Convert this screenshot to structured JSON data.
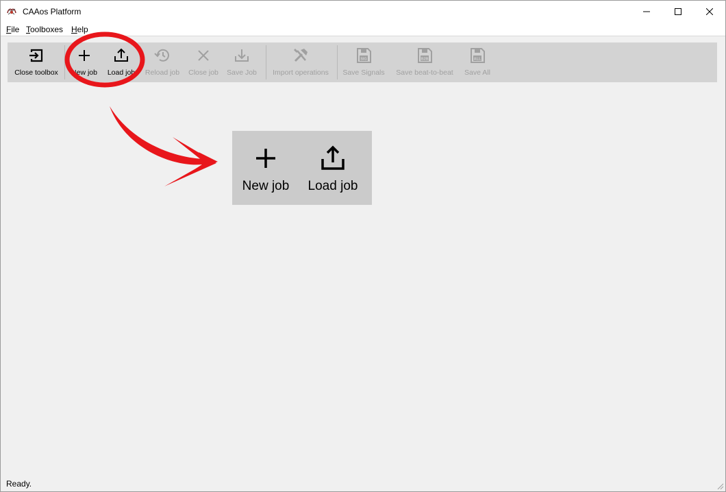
{
  "window": {
    "title": "CAAos Platform"
  },
  "menu": {
    "file": {
      "underline": "F",
      "rest": "ile"
    },
    "toolboxes": {
      "underline": "T",
      "rest": "oolboxes"
    },
    "help": {
      "underline": "H",
      "rest": "elp"
    }
  },
  "toolbar": {
    "close_toolbox": "Close toolbox",
    "new_job": "New job",
    "load_job": "Load job",
    "reload_job": "Reload job",
    "close_job": "Close job",
    "save_job": "Save Job",
    "import_operations": "Import operations",
    "save_signals": "Save Signals",
    "save_beat": "Save beat-to-beat",
    "save_all": "Save All",
    "sig_tag": "SIG",
    "b2b_tag": "B2B",
    "all_tag": "ALL"
  },
  "zoom_callout": {
    "new_job": "New job",
    "load_job": "Load job"
  },
  "status": {
    "text": "Ready."
  },
  "colors": {
    "annotation": "#e8161b",
    "toolbar_bg": "#d3d3d3",
    "disabled": "#a0a0a0"
  }
}
